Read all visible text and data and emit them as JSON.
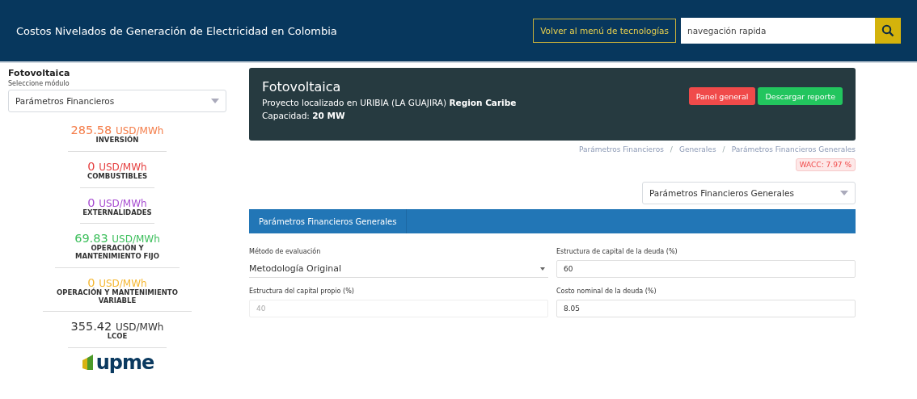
{
  "header": {
    "title": "Costos Nivelados de Generación de Electricidad en Colombia",
    "back_button": "Volver al menú de tecnologías",
    "search": {
      "placeholder": "navegación rapida"
    }
  },
  "sidebar": {
    "technology": "Fotovoltaica",
    "module_label": "Seleccione módulo",
    "module_select": "Parámetros Financieros",
    "metrics": [
      {
        "value": "285.58",
        "unit": "USD/MWh",
        "label": "INVERSIÓN",
        "color": "#f47c48"
      },
      {
        "value": "0",
        "unit": "USD/MWh",
        "label": "COMBUSTIBLES",
        "color": "#e53e3e"
      },
      {
        "value": "0",
        "unit": "USD/MWh",
        "label": "EXTERNALIDADES",
        "color": "#a64bd0"
      },
      {
        "value": "69.83",
        "unit": "USD/MWh",
        "label": "OPERACIÓN Y MANTENIMIENTO FIJO",
        "color": "#3dbf5c"
      },
      {
        "value": "0",
        "unit": "USD/MWh",
        "label": "OPERACIÓN Y MANTENIMIENTO VARIABLE",
        "color": "#f5b731"
      },
      {
        "value": "355.42",
        "unit": "USD/MWh",
        "label": "LCOE",
        "color": "#333333"
      }
    ],
    "logo": "upme"
  },
  "project": {
    "title": "Fotovoltaica",
    "location": "Proyecto localizado en URIBIA (LA GUAJIRA) **Region Caribe**",
    "capacity": "Capacidad: **20 MW**",
    "buttons": [
      {
        "label": "Panel general",
        "kind": "danger"
      },
      {
        "label": "Descargar reporte",
        "kind": "success"
      }
    ]
  },
  "breadcrumb": [
    {
      "text": "Parámetros Financieros",
      "kind": "link"
    },
    {
      "text": "/",
      "kind": "separator"
    },
    {
      "text": "Generales",
      "kind": "link"
    },
    {
      "text": "/",
      "kind": "separator"
    },
    {
      "text": "Parámetros Financieros Generales",
      "kind": "link"
    }
  ],
  "wacc": "WACC: 7.97 %",
  "section_select": "Parámetros Financieros Generales",
  "panel": {
    "title": "Parámetros Financieros Generales",
    "fields": [
      {
        "label": "Método de evaluación",
        "value": "Metodología Original",
        "kind": "select",
        "disabled": false
      },
      {
        "label": "Estructura de capital de la deuda (%)",
        "value": "60",
        "kind": "input",
        "disabled": false
      },
      {
        "label": "Estructura del capital propio (%)",
        "value": "40",
        "kind": "input",
        "disabled": true
      },
      {
        "label": "Costo nominal de la deuda (%)",
        "value": "8.05",
        "kind": "input",
        "disabled": false
      }
    ]
  }
}
